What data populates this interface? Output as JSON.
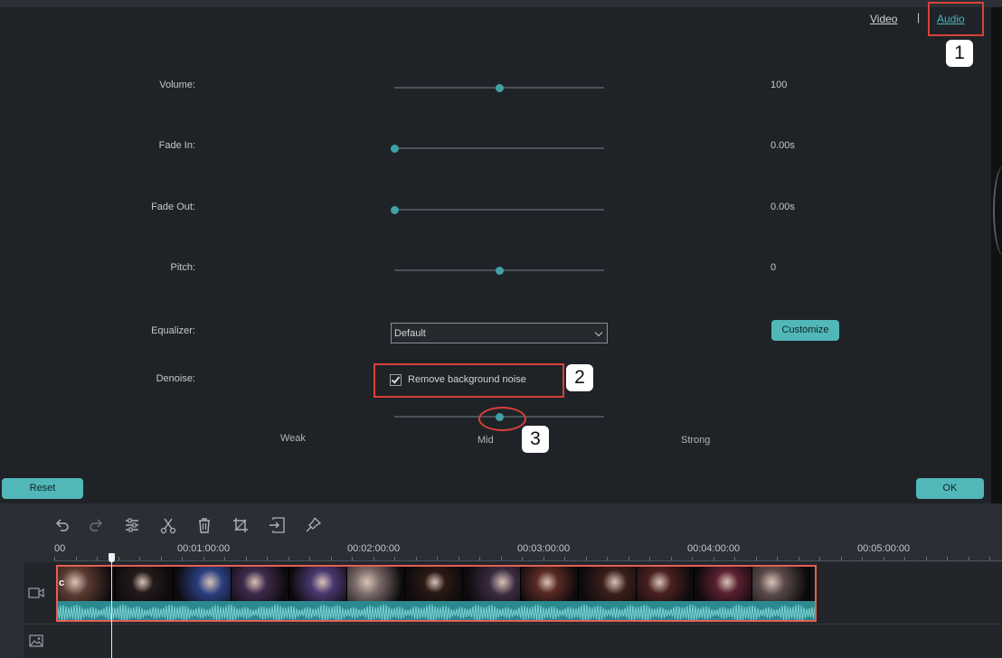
{
  "tabs": {
    "video": "Video",
    "separator": "|",
    "audio": "Audio"
  },
  "callouts": [
    "1",
    "2",
    "3"
  ],
  "rows": {
    "volume": {
      "label": "Volume:",
      "value": "100",
      "level": 0.5
    },
    "fade_in": {
      "label": "Fade In:",
      "value": "0.00s",
      "level": 0.0
    },
    "fade_out": {
      "label": "Fade Out:",
      "value": "0.00s",
      "level": 0.0
    },
    "pitch": {
      "label": "Pitch:",
      "value": "0",
      "level": 0.5
    }
  },
  "equalizer": {
    "label": "Equalizer:",
    "selected": "Default",
    "customize_label": "Customize"
  },
  "denoise": {
    "label": "Denoise:",
    "checkbox_label": "Remove background noise",
    "checked": true,
    "level": 0.5,
    "scale": {
      "weak": "Weak",
      "mid": "Mid",
      "strong": "Strong"
    }
  },
  "buttons": {
    "reset": "Reset",
    "ok": "OK"
  },
  "toolbar": {
    "icons": [
      "undo-icon",
      "redo-icon",
      "adjust-icon",
      "cut-icon",
      "delete-icon",
      "crop-icon",
      "split-icon",
      "marker-icon"
    ]
  },
  "ruler": {
    "ticks": [
      "00",
      "00:01:00:00",
      "00:02:00:00",
      "00:03:00:00",
      "00:04:00:00",
      "00:05:00:00"
    ]
  },
  "timeline": {
    "clip_first_letter": "c",
    "thumb_colors": [
      "#5a3a30",
      "#231a1a",
      "#2a3f80",
      "#3e2a4a",
      "#4a3870",
      "#7a6a68",
      "#2a1a14",
      "#3a2a40",
      "#5a2a24",
      "#3a1e1a",
      "#4a2020",
      "#5a2030",
      "#5a4a4a"
    ]
  },
  "colors": {
    "accent": "#52b7b8",
    "callout": "#d8403a",
    "clip_border": "#e45f54",
    "wave": "#2b8a90"
  }
}
